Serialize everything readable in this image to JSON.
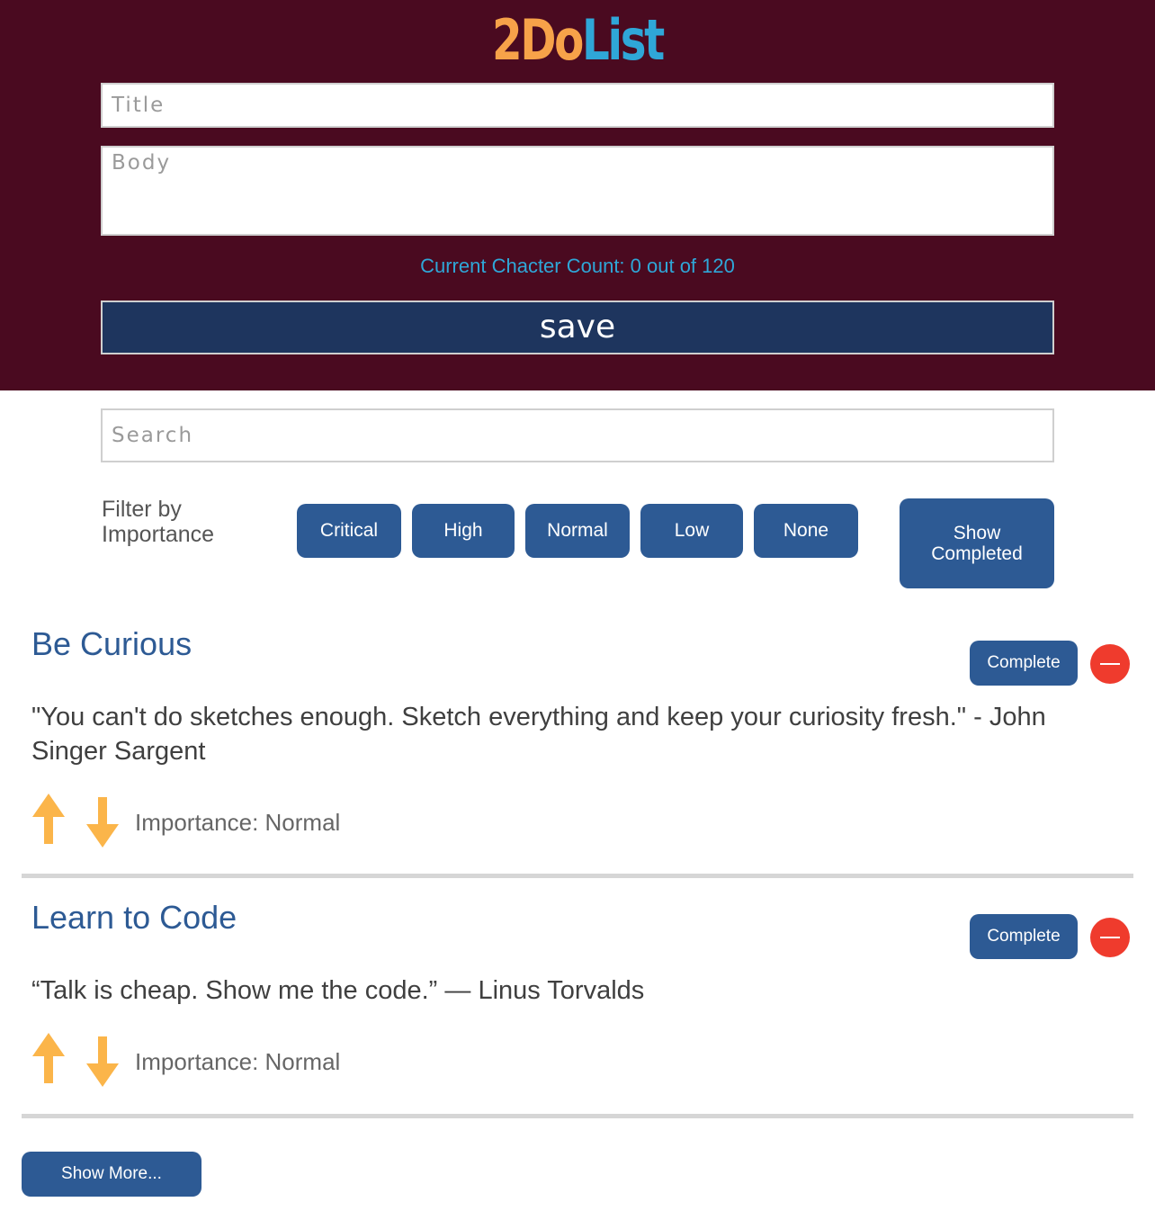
{
  "app": {
    "logo_part1": "2Do",
    "logo_part2": "List",
    "colors": {
      "header_bg": "#4a0a20",
      "logo_orange": "#f7a249",
      "logo_blue": "#2fa7d8",
      "primary": "#2d5a94",
      "save_bg": "#1e355e",
      "delete_red": "#ef3b2d",
      "arrow_yellow": "#fbb54a"
    }
  },
  "form": {
    "title_placeholder": "Title",
    "body_placeholder": "Body",
    "char_count_text": "Current Chacter Count: 0 out of 120",
    "save_label": "save"
  },
  "search": {
    "placeholder": "Search"
  },
  "filters": {
    "label": "Filter by Importance",
    "buttons": [
      "Critical",
      "High",
      "Normal",
      "Low",
      "None"
    ],
    "show_completed_label": "Show Completed"
  },
  "todos": [
    {
      "title": "Be Curious",
      "body": "\"You can't do sketches enough. Sketch everything and keep your curiosity fresh.\" - John Singer Sargent",
      "importance_text": "Importance: Normal",
      "complete_label": "Complete",
      "upvote_icon": "arrow-up-icon",
      "downvote_icon": "arrow-down-icon",
      "delete_icon": "minus-circle-icon"
    },
    {
      "title": "Learn to Code",
      "body": "“Talk is cheap. Show me the code.” ― Linus Torvalds",
      "importance_text": "Importance: Normal",
      "complete_label": "Complete",
      "upvote_icon": "arrow-up-icon",
      "downvote_icon": "arrow-down-icon",
      "delete_icon": "minus-circle-icon"
    }
  ],
  "footer": {
    "show_more_label": "Show More..."
  }
}
